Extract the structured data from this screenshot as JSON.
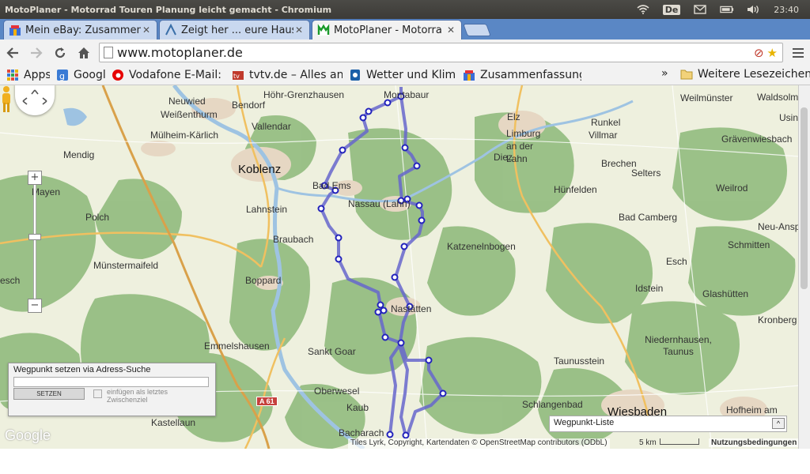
{
  "window": {
    "title": "MotoPlaner - Motorrad Touren Planung leicht gemacht - Chromium",
    "keyboard_layout": "De",
    "clock": "23:40"
  },
  "tabs": [
    {
      "label": "Mein eBay: Zusammen",
      "icon": "ebay-favicon"
    },
    {
      "label": "Zeigt her ... eure Haus",
      "icon": "forum-favicon"
    },
    {
      "label": "MotoPlaner - Motorra",
      "icon": "motoplaner-favicon",
      "active": true
    }
  ],
  "toolbar": {
    "url": "www.motoplaner.de"
  },
  "bookmarks": {
    "items": [
      {
        "label": "Apps",
        "icon": "apps-grid-icon"
      },
      {
        "label": "Google",
        "icon": "google-favicon"
      },
      {
        "label": "Vodafone E-Mail: P",
        "icon": "vodafone-favicon"
      },
      {
        "label": "tvtv.de – Alles and",
        "icon": "tvtv-favicon"
      },
      {
        "label": "Wetter und Klima",
        "icon": "wetter-favicon"
      },
      {
        "label": "Zusammenfassung",
        "icon": "ebay-favicon"
      }
    ],
    "overflow": "»",
    "other_folder": "Weitere Lesezeichen"
  },
  "map": {
    "places": [
      {
        "name": "Montabaur"
      },
      {
        "name": "Höhr-Grenzhausen"
      },
      {
        "name": "Neuwied"
      },
      {
        "name": "Weißenthurm"
      },
      {
        "name": "Bendorf"
      },
      {
        "name": "Vallendar"
      },
      {
        "name": "Mülheim-Kärlich"
      },
      {
        "name": "Koblenz"
      },
      {
        "name": "Mendig"
      },
      {
        "name": "Mayen"
      },
      {
        "name": "Polch"
      },
      {
        "name": "Lahnstein"
      },
      {
        "name": "Braubach"
      },
      {
        "name": "Münstermaifeld"
      },
      {
        "name": "Boppard"
      },
      {
        "name": "Emmelshausen"
      },
      {
        "name": "Sankt Goar"
      },
      {
        "name": "Oberwesel"
      },
      {
        "name": "Kaub"
      },
      {
        "name": "Bacharach"
      },
      {
        "name": "Kastellaun"
      },
      {
        "name": "Bad Ems"
      },
      {
        "name": "Nassau (Lahn)"
      },
      {
        "name": "Nastätten"
      },
      {
        "name": "Katzenelnbogen"
      },
      {
        "name": "Elz"
      },
      {
        "name": "Limburg an der Lahn"
      },
      {
        "name": "Diez"
      },
      {
        "name": "Runkel"
      },
      {
        "name": "Villmar"
      },
      {
        "name": "Brechen"
      },
      {
        "name": "Selters"
      },
      {
        "name": "Hünfelden"
      },
      {
        "name": "Weilrod"
      },
      {
        "name": "Bad Camberg"
      },
      {
        "name": "Esch"
      },
      {
        "name": "Idstein"
      },
      {
        "name": "Schmitten"
      },
      {
        "name": "Neu-Ansp"
      },
      {
        "name": "Glashütten"
      },
      {
        "name": "Niedernhausen, Taunus"
      },
      {
        "name": "Kronberg"
      },
      {
        "name": "Taunusstein"
      },
      {
        "name": "Schlangenbad"
      },
      {
        "name": "Wiesbaden"
      },
      {
        "name": "Hofheim am"
      },
      {
        "name": "Weilmünster"
      },
      {
        "name": "Waldsolm"
      },
      {
        "name": "Grävenwiesbach"
      },
      {
        "name": "Usingen"
      },
      {
        "name": "esch"
      }
    ],
    "highway_shield": "A 61",
    "search_panel": {
      "title": "Wegpunkt setzen via Adress-Suche",
      "input_value": "",
      "button": "SETZEN",
      "checkbox_label_1": "einfügen als letztes",
      "checkbox_label_2": "Zwischenziel"
    },
    "waypoint_panel": {
      "title": "Wegpunkt-Liste",
      "toggle": "^"
    },
    "google_logo": "Google",
    "attribution": "Tiles Lyrk, Copyright, Kartendaten © OpenStreetMap contributors (ODbL)",
    "scale_label": "5 km",
    "terms": "Nutzungsbedingungen",
    "zoom_in": "+",
    "zoom_out": "−"
  },
  "colors": {
    "route": "#6666cc",
    "waypoint_fill": "#ffffff",
    "waypoint_stroke": "#2222bb",
    "forest": "#8cb879",
    "settlement": "#e6d7c3",
    "water": "#9ec3e2"
  }
}
